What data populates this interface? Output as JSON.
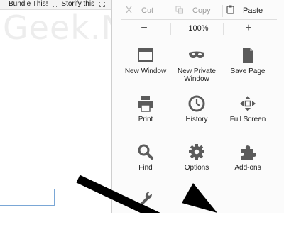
{
  "bookmarks": [
    "Bundle This!",
    "Storify this"
  ],
  "watermark": "Geek.NG",
  "edit": {
    "cut": "Cut",
    "copy": "Copy",
    "paste": "Paste"
  },
  "zoom": {
    "out": "−",
    "level": "100%",
    "in": "+"
  },
  "menu_items": [
    {
      "label": "New Window",
      "icon": "new-window-icon"
    },
    {
      "label": "New Private Window",
      "icon": "private-mask-icon"
    },
    {
      "label": "Save Page",
      "icon": "save-page-icon"
    },
    {
      "label": "Print",
      "icon": "printer-icon"
    },
    {
      "label": "History",
      "icon": "clock-icon"
    },
    {
      "label": "Full Screen",
      "icon": "fullscreen-icon"
    },
    {
      "label": "Find",
      "icon": "magnifier-icon"
    },
    {
      "label": "Options",
      "icon": "gear-icon"
    },
    {
      "label": "Add-ons",
      "icon": "puzzle-icon"
    },
    {
      "label": "",
      "icon": "wrench-icon"
    }
  ],
  "colors": {
    "icon": "#5b5b5b",
    "input_border": "#7aa7d6",
    "panel": "#fbfbfb",
    "arrow": "#000000"
  }
}
